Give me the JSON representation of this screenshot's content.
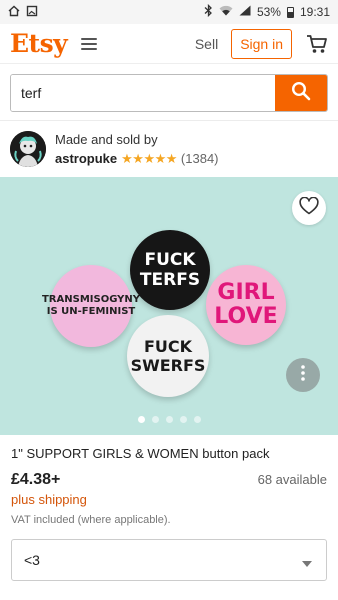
{
  "status_bar": {
    "battery": "53%",
    "time": "19:31",
    "icons": [
      "home-outline-icon",
      "image-icon",
      "bluetooth-icon",
      "wifi-icon",
      "signal-icon",
      "battery-icon"
    ]
  },
  "header": {
    "logo": "Etsy",
    "sell_label": "Sell",
    "signin_label": "Sign in",
    "brand_color": "#f56400"
  },
  "search": {
    "value": "terf"
  },
  "seller": {
    "made_by": "Made and sold by",
    "shop_name": "astropuke",
    "stars": "★★★★★",
    "rating": 5,
    "review_count": "(1384)"
  },
  "product_image": {
    "background": "#bfe5df",
    "badges": [
      {
        "text": "FUCK TERFS"
      },
      {
        "text": "TRANSMISOGYNY IS UN-FEMINIST"
      },
      {
        "text": "GIRL LOVE"
      },
      {
        "text": "FUCK SWERFS"
      }
    ],
    "carousel": {
      "count": 5,
      "active": 0
    }
  },
  "product": {
    "title": "1\" SUPPORT GIRLS & WOMEN button pack",
    "price": "£4.38+",
    "available": "68 available",
    "shipping": "plus shipping",
    "vat": "VAT included (where applicable)."
  },
  "variation_select": {
    "value": "<3"
  }
}
